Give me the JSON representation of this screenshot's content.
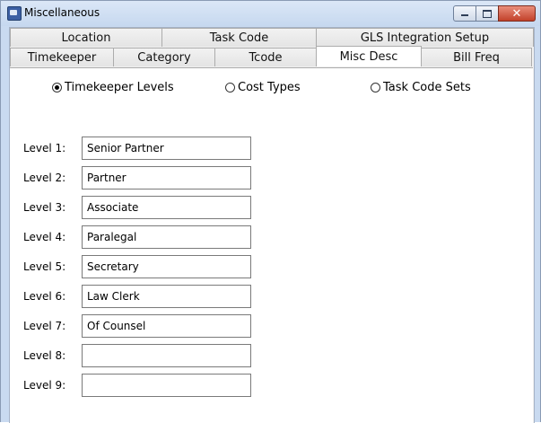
{
  "window": {
    "title": "Miscellaneous"
  },
  "tabs": {
    "row1": [
      {
        "label": "Location"
      },
      {
        "label": "Task Code"
      },
      {
        "label": "GLS Integration Setup"
      }
    ],
    "row2": [
      {
        "label": "Timekeeper"
      },
      {
        "label": "Category"
      },
      {
        "label": "Tcode"
      },
      {
        "label": "Misc Desc",
        "active": true
      },
      {
        "label": "Bill Freq"
      }
    ]
  },
  "radios": {
    "timekeeper_levels": {
      "label": "Timekeeper Levels",
      "checked": true
    },
    "cost_types": {
      "label": "Cost Types",
      "checked": false
    },
    "task_code_sets": {
      "label": "Task Code Sets",
      "checked": false
    }
  },
  "levels": [
    {
      "label": "Level 1:",
      "value": "Senior Partner"
    },
    {
      "label": "Level 2:",
      "value": "Partner"
    },
    {
      "label": "Level 3:",
      "value": "Associate"
    },
    {
      "label": "Level 4:",
      "value": "Paralegal"
    },
    {
      "label": "Level 5:",
      "value": "Secretary"
    },
    {
      "label": "Level 6:",
      "value": "Law Clerk"
    },
    {
      "label": "Level 7:",
      "value": "Of Counsel"
    },
    {
      "label": "Level 8:",
      "value": ""
    },
    {
      "label": "Level 9:",
      "value": ""
    }
  ]
}
